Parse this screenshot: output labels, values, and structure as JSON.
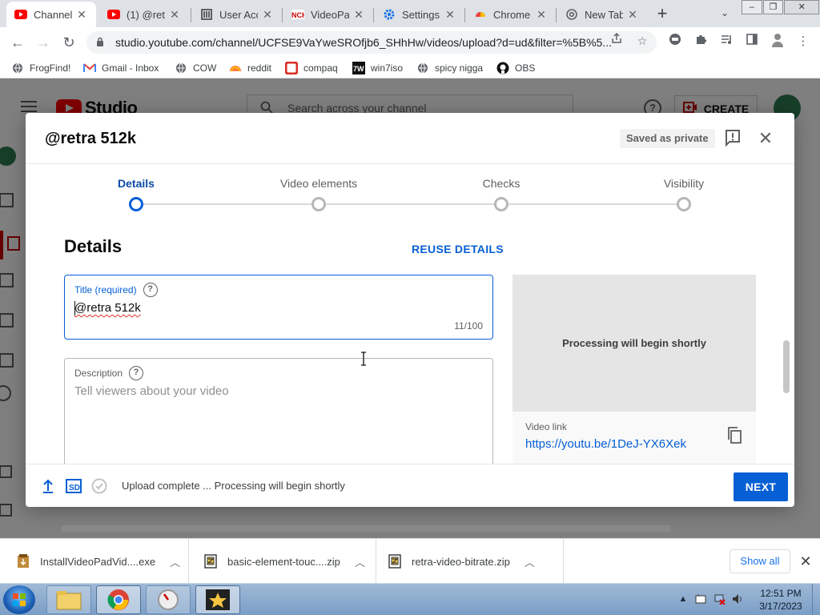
{
  "browser": {
    "tabs": [
      {
        "title": "Channel",
        "icon": "youtube-icon"
      },
      {
        "title": "(1) @retr",
        "icon": "youtube-icon"
      },
      {
        "title": "User Acc",
        "icon": "library-icon"
      },
      {
        "title": "VideoPad",
        "icon": "nch-icon"
      },
      {
        "title": "Settings",
        "icon": "settings-gear-icon"
      },
      {
        "title": "Chrome",
        "icon": "chrome-flag-icon"
      },
      {
        "title": "New Tab",
        "icon": "chrome-icon"
      }
    ],
    "url": "studio.youtube.com/channel/UCFSE9VaYweSROfjb6_SHhHw/videos/upload?d=ud&filter=%5B%5...",
    "bookmarks": [
      {
        "label": "FrogFind!",
        "icon": "globe-icon"
      },
      {
        "label": "Gmail - Inbox",
        "icon": "gmail-icon"
      },
      {
        "label": "COW",
        "icon": "globe-icon"
      },
      {
        "label": "reddit",
        "icon": "reddit-icon"
      },
      {
        "label": "compaq",
        "icon": "compaq-icon"
      },
      {
        "label": "win7iso",
        "icon": "win7iso-icon"
      },
      {
        "label": "spicy nigga",
        "icon": "globe-icon"
      },
      {
        "label": "OBS",
        "icon": "github-icon"
      }
    ]
  },
  "studio": {
    "search_placeholder": "Search across your channel",
    "create_label": "CREATE"
  },
  "modal": {
    "title": "@retra 512k",
    "saved_badge": "Saved as private",
    "steps": [
      {
        "label": "Details",
        "active": true
      },
      {
        "label": "Video elements",
        "active": false
      },
      {
        "label": "Checks",
        "active": false
      },
      {
        "label": "Visibility",
        "active": false
      }
    ],
    "section_title": "Details",
    "reuse_label": "REUSE DETAILS",
    "title_field": {
      "label": "Title (required)",
      "value": "@retra 512k",
      "count": "11/100"
    },
    "description_field": {
      "label": "Description",
      "placeholder": "Tell viewers about your video"
    },
    "preview": {
      "status": "Processing will begin shortly",
      "link_label": "Video link",
      "link_url": "https://youtu.be/1DeJ-YX6Xek"
    },
    "footer": {
      "quality_badge": "SD",
      "status": "Upload complete ... Processing will begin shortly",
      "next_label": "NEXT"
    }
  },
  "downloads": {
    "items": [
      {
        "name": "InstallVideoPadVid....exe"
      },
      {
        "name": "basic-element-touc....zip"
      },
      {
        "name": "retra-video-bitrate.zip"
      }
    ],
    "show_all": "Show all"
  },
  "taskbar": {
    "time": "12:51 PM",
    "date": "3/17/2023"
  },
  "colors": {
    "accent_blue": "#065fd4",
    "youtube_red": "#ff0000"
  }
}
